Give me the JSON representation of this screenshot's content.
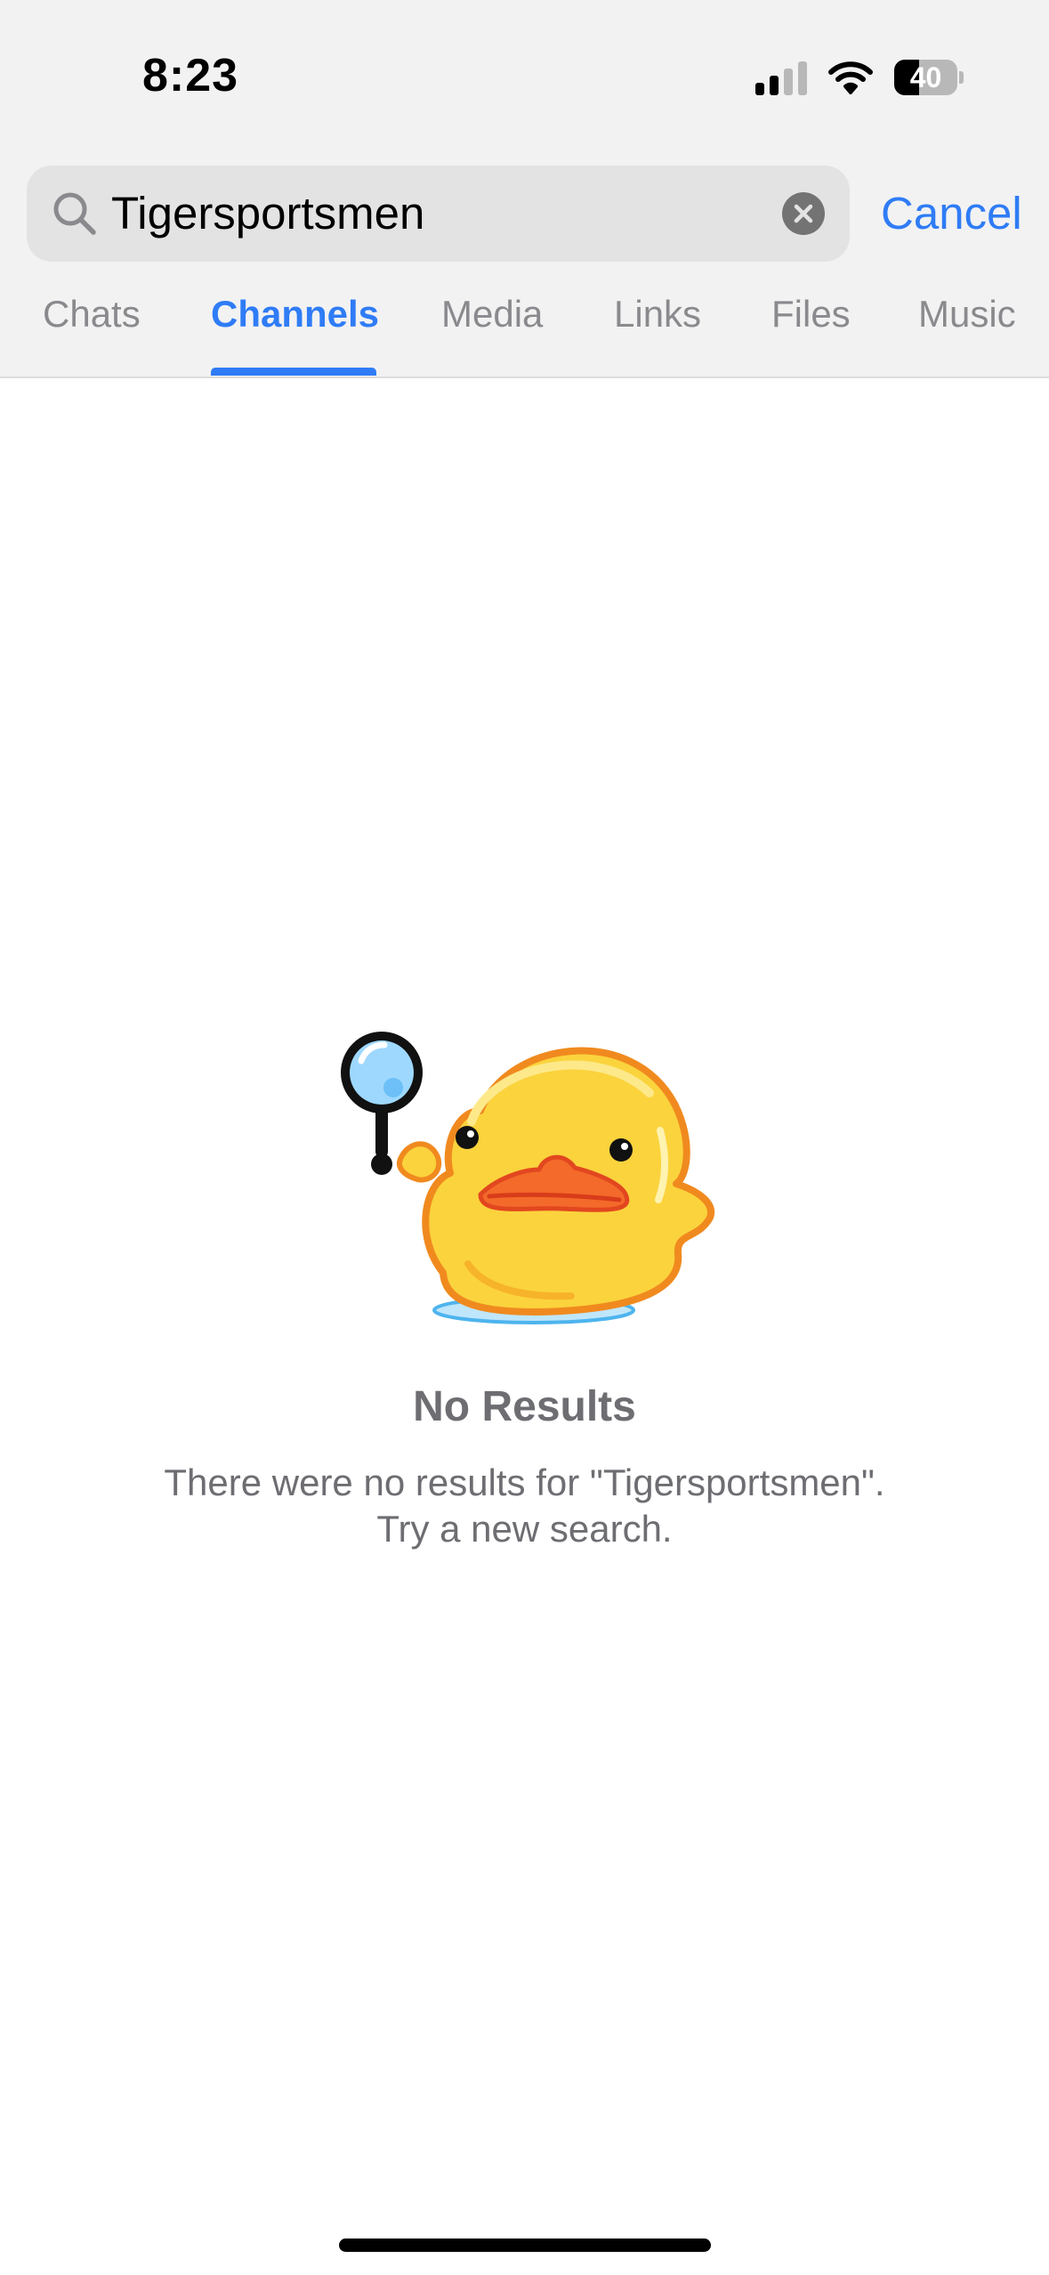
{
  "status_bar": {
    "time": "8:23",
    "battery_level": "40",
    "signal_bars_active": 2,
    "signal_bars_total": 4,
    "icons": [
      "cellular-signal-icon",
      "wifi-icon",
      "battery-icon"
    ]
  },
  "search": {
    "query": "Tigersportsmen",
    "cancel_label": "Cancel"
  },
  "tabs": [
    {
      "label": "Chats",
      "active": false
    },
    {
      "label": "Channels",
      "active": true
    },
    {
      "label": "Media",
      "active": false
    },
    {
      "label": "Links",
      "active": false
    },
    {
      "label": "Files",
      "active": false
    },
    {
      "label": "Music",
      "active": false
    }
  ],
  "empty_state": {
    "illustration": "duck-with-magnifier",
    "title": "No Results",
    "message_line1": "There were no results for \"Tigersportsmen\".",
    "message_line2": "Try a new search."
  },
  "colors": {
    "accent": "#2f7cf6",
    "header_bg": "#f2f2f2",
    "search_field_bg": "#e3e3e3",
    "inactive_tab": "#8a8a8e",
    "secondary_text": "#6d6d72"
  }
}
